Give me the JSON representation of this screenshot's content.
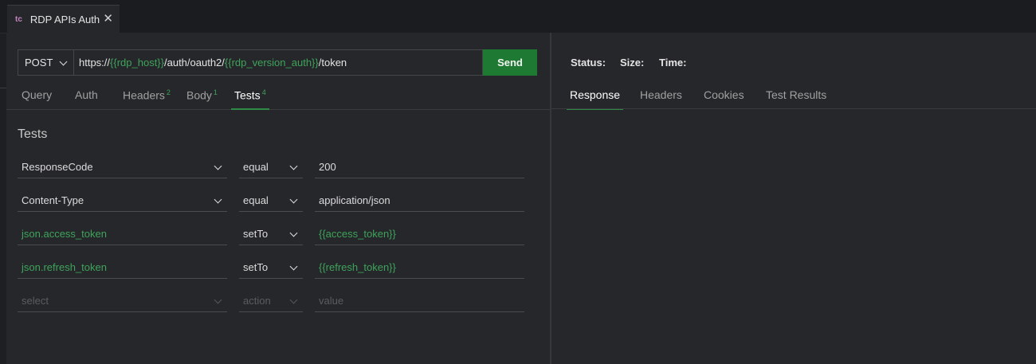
{
  "tab": {
    "prefix": "tc",
    "title": "RDP APIs Auth",
    "close": "✕"
  },
  "request": {
    "method": "POST",
    "url_parts": [
      {
        "text": "https://",
        "var": false
      },
      {
        "text": "{{rdp_host}}",
        "var": true
      },
      {
        "text": "/auth/oauth2/",
        "var": false
      },
      {
        "text": "{{rdp_version_auth}}",
        "var": true
      },
      {
        "text": "/token",
        "var": false
      }
    ],
    "send_label": "Send"
  },
  "subtabs": [
    {
      "label": "Query",
      "count": ""
    },
    {
      "label": "Auth",
      "count": ""
    },
    {
      "label": "Headers",
      "count": "2"
    },
    {
      "label": "Body",
      "count": "1"
    },
    {
      "label": "Tests",
      "count": "4",
      "active": true
    }
  ],
  "tests": {
    "title": "Tests",
    "rows": [
      {
        "select": "ResponseCode",
        "action": "equal",
        "value": "200"
      },
      {
        "select": "Content-Type",
        "action": "equal",
        "value": "application/json"
      },
      {
        "select": "json.access_token",
        "action": "setTo",
        "value": "{{access_token}}"
      },
      {
        "select": "json.refresh_token",
        "action": "setTo",
        "value": "{{refresh_token}}"
      }
    ],
    "placeholder": {
      "select": "select",
      "action": "action",
      "value": "value"
    }
  },
  "response": {
    "status_label": "Status:",
    "size_label": "Size:",
    "time_label": "Time:",
    "tabs": [
      "Response",
      "Headers",
      "Cookies",
      "Test Results"
    ]
  },
  "colors": {
    "accent": "#1e7a32",
    "variable": "#3fa35a",
    "background": "#25272b"
  }
}
